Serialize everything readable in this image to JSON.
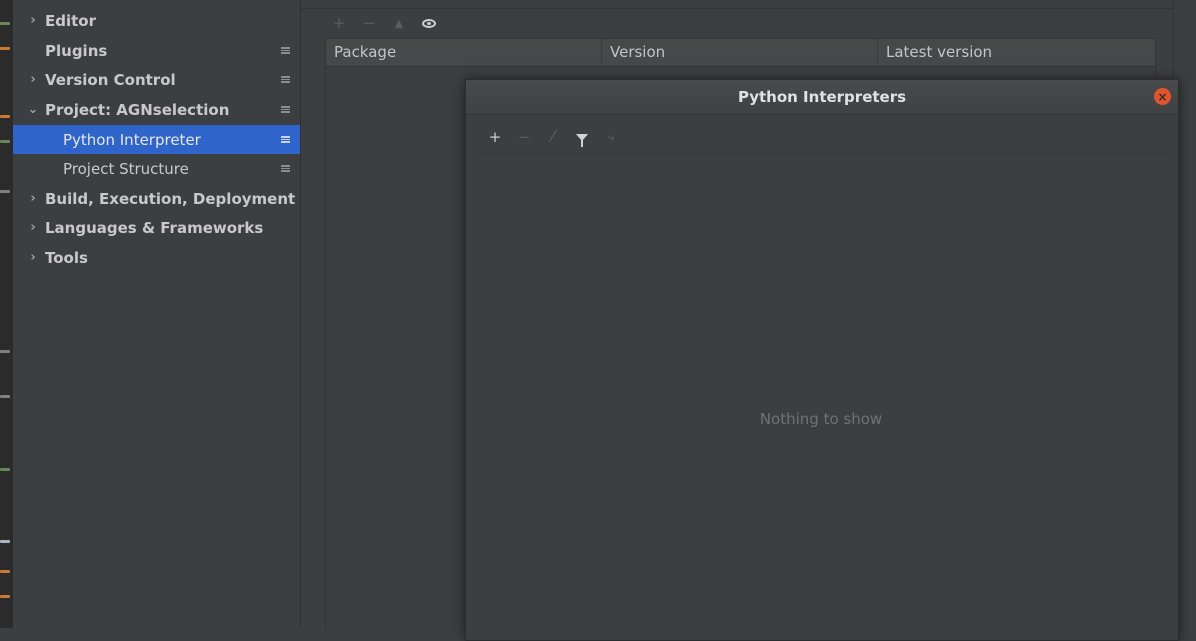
{
  "sidebar": {
    "items": [
      {
        "label": "Editor",
        "expandable": true,
        "bold": true
      },
      {
        "label": "Plugins",
        "expandable": false,
        "bold": true
      },
      {
        "label": "Version Control",
        "expandable": true,
        "bold": true
      },
      {
        "label": "Project: AGNselection",
        "expandable": true,
        "expanded": true,
        "bold": true
      },
      {
        "label": "Python Interpreter",
        "child": true,
        "selected": true
      },
      {
        "label": "Project Structure",
        "child": true
      },
      {
        "label": "Build, Execution, Deployment",
        "expandable": true,
        "bold": true
      },
      {
        "label": "Languages & Frameworks",
        "expandable": true,
        "bold": true
      },
      {
        "label": "Tools",
        "expandable": true,
        "bold": true
      }
    ],
    "arrow_collapsed": "›",
    "arrow_expanded": "⌄"
  },
  "packages": {
    "toolbar": {
      "add": "+",
      "remove": "−",
      "upgrade": "▲",
      "show_early_releases_icon": "eye-icon"
    },
    "columns": [
      "Package",
      "Version",
      "Latest version"
    ]
  },
  "dialog": {
    "title": "Python Interpreters",
    "close": "×",
    "toolbar": {
      "add": "+",
      "remove": "−",
      "edit": "⁄",
      "filter_icon": "filter-icon",
      "paths": "⤷"
    },
    "empty_text": "Nothing to show"
  },
  "colors": {
    "selection": "#2f65ca",
    "close_button": "#e0542e",
    "background": "#3c3f41"
  }
}
